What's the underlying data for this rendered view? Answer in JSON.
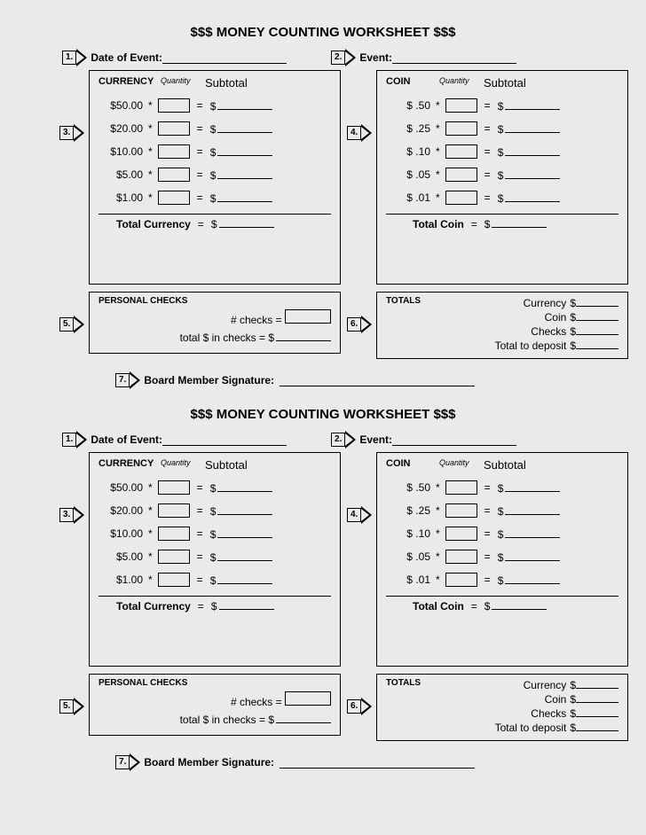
{
  "title": "$$$ MONEY COUNTING WORKSHEET $$$",
  "step1": {
    "num": "1.",
    "label": "Date of Event:"
  },
  "step2": {
    "num": "2.",
    "label": "Event:"
  },
  "step3": {
    "num": "3."
  },
  "step4": {
    "num": "4."
  },
  "step5": {
    "num": "5."
  },
  "step6": {
    "num": "6."
  },
  "step7": {
    "num": "7.",
    "label": "Board Member Signature:"
  },
  "currency": {
    "header": "CURRENCY",
    "qty": "Quantity",
    "subtotal": "Subtotal",
    "rows": [
      "$50.00",
      "$20.00",
      "$10.00",
      "$5.00",
      "$1.00"
    ],
    "total": "Total Currency",
    "eq": "=",
    "dollar": "$",
    "star": "*"
  },
  "coin": {
    "header": "COIN",
    "qty": "Quantity",
    "subtotal": "Subtotal",
    "rows": [
      "$ .50",
      "$ .25",
      "$ .10",
      "$ .05",
      "$ .01"
    ],
    "total": "Total Coin",
    "eq": "=",
    "dollar": "$",
    "star": "*"
  },
  "checks": {
    "header": "PERSONAL CHECKS",
    "numchecks": "# checks =",
    "totalchecks": "total $ in checks =",
    "dollar": "$"
  },
  "totals": {
    "header": "TOTALS",
    "currency": "Currency",
    "coin": "Coin",
    "checks": "Checks",
    "deposit": "Total to deposit",
    "dollar": "$"
  }
}
